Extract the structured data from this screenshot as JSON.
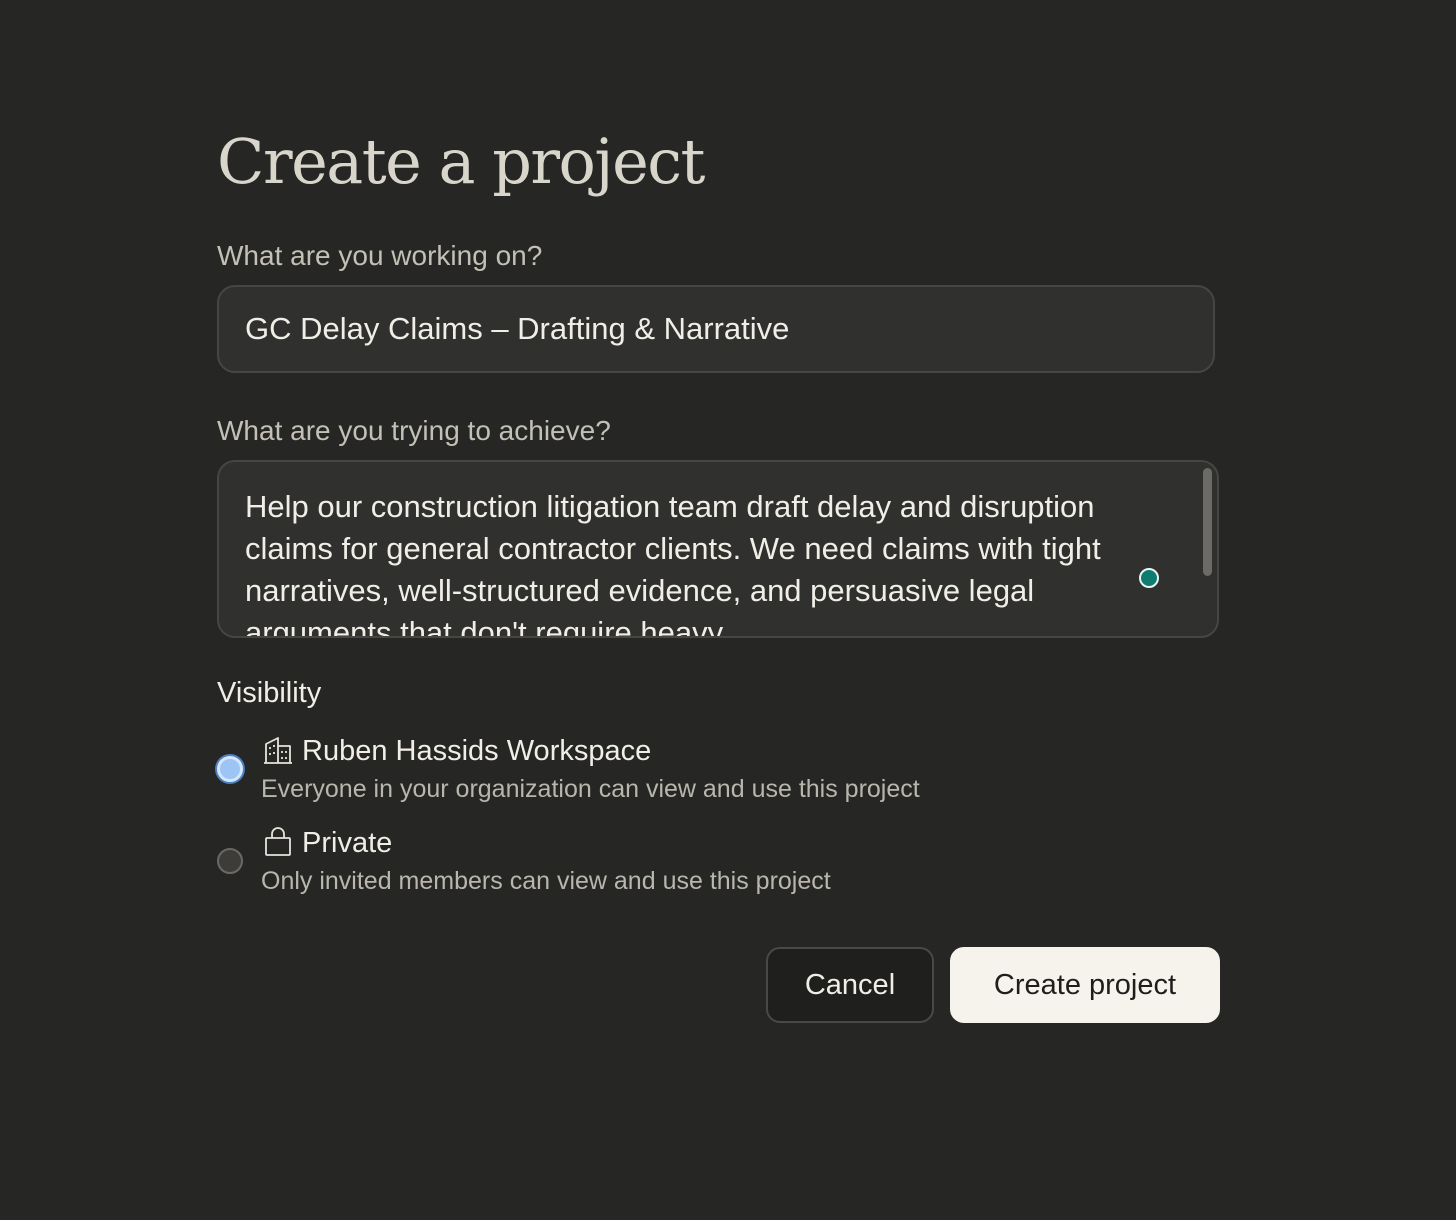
{
  "page": {
    "title": "Create a project"
  },
  "name_field": {
    "label": "What are you working on?",
    "value": "GC Delay Claims – Drafting & Narrative"
  },
  "goal_field": {
    "label": "What are you trying to achieve?",
    "value": "Help our construction litigation team draft delay and disruption claims for general contractor clients. We need claims with tight narratives, well-structured evidence, and persuasive legal arguments that don't require heavy"
  },
  "visibility": {
    "label": "Visibility",
    "options": [
      {
        "title": "Ruben Hassids Workspace",
        "description": "Everyone in your organization can view and use this project",
        "icon": "building-icon",
        "selected": true
      },
      {
        "title": "Private",
        "description": "Only invited members can view and use this project",
        "icon": "lock-icon",
        "selected": false
      }
    ]
  },
  "actions": {
    "cancel_label": "Cancel",
    "create_label": "Create project"
  },
  "colors": {
    "background": "#262624",
    "field_background": "#30302e",
    "primary_button": "#f5f3ec",
    "radio_selected": "#9cc4f5",
    "cursor_dot": "#0f7c72"
  }
}
